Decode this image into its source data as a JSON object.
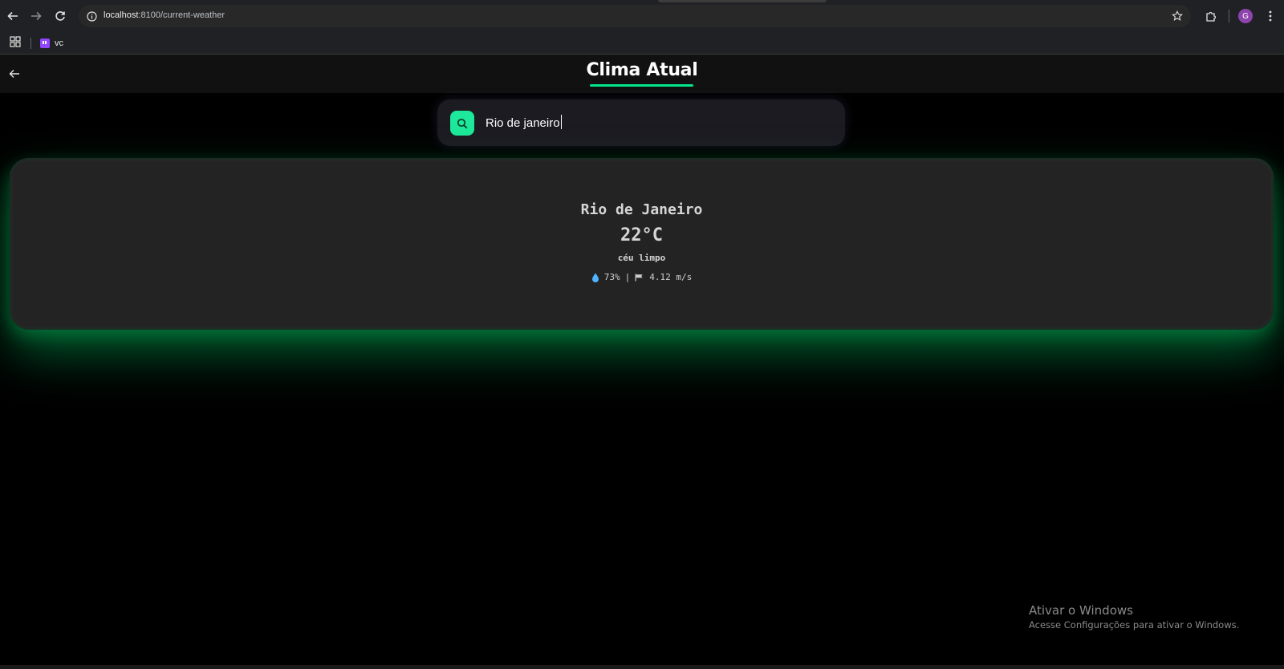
{
  "browser": {
    "url_host": "localhost",
    "url_path": ":8100/current-weather",
    "avatar_letter": "G",
    "bookmark_label": "vc"
  },
  "header": {
    "title": "Clima Atual",
    "accent_color": "#00e68a"
  },
  "search": {
    "value": "Rio de janeiro",
    "button_color": "#1de89b",
    "icon": "search-icon"
  },
  "weather": {
    "city": "Rio de Janeiro",
    "temperature": "22°C",
    "description": "céu limpo",
    "humidity": "73%",
    "separator": "|",
    "wind": "4.12 m/s",
    "humidity_icon": "water-drop-icon",
    "wind_icon": "wind-flag-icon"
  },
  "watermark": {
    "title": "Ativar o Windows",
    "subtitle": "Acesse Configurações para ativar o Windows."
  }
}
